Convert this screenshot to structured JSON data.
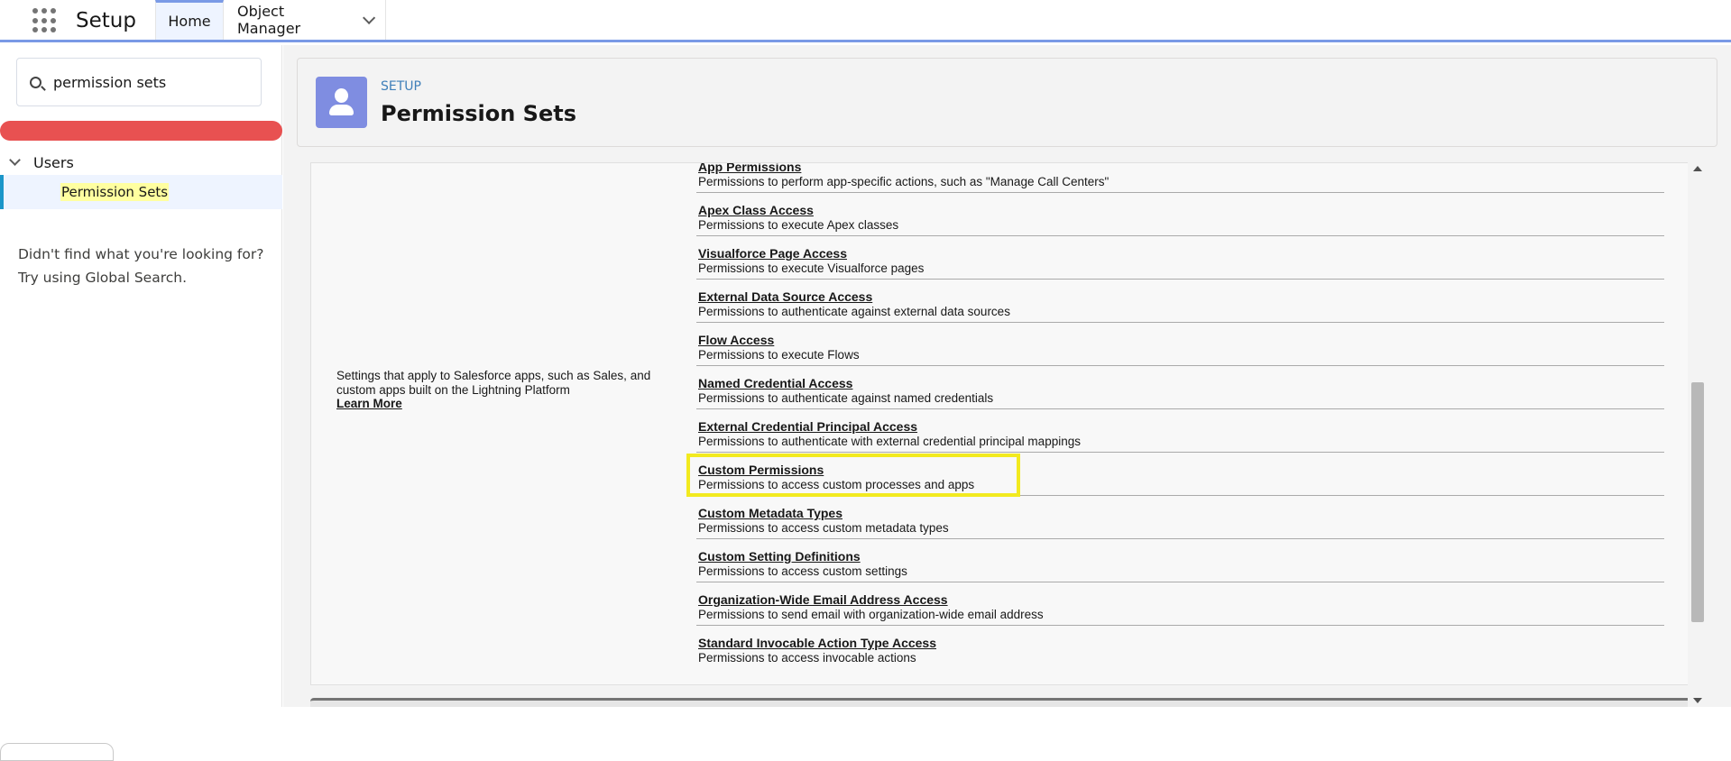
{
  "app": {
    "title": "Setup",
    "launcher_icon": "app-launcher-icon"
  },
  "nav": {
    "tabs": [
      {
        "label": "Home",
        "active": true
      },
      {
        "label": "Object Manager",
        "has_dropdown": true
      }
    ]
  },
  "sidebar": {
    "search": {
      "value": "permission sets",
      "placeholder": "Quick Find"
    },
    "tree": {
      "group_label": "Users",
      "item_label": "Permission Sets"
    },
    "not_found_line1": "Didn't find what you're looking for?",
    "not_found_line2": "Try using Global Search."
  },
  "header": {
    "breadcrumb": "SETUP",
    "title": "Permission Sets",
    "icon_color": "#7f8de1"
  },
  "content": {
    "description": "Settings that apply to Salesforce apps, such as Sales, and custom apps built on the Lightning Platform",
    "learn_more": "Learn More",
    "permissions": [
      {
        "title": "App Permissions",
        "desc": "Permissions to perform app-specific actions, such as \"Manage Call Centers\""
      },
      {
        "title": "Apex Class Access",
        "desc": "Permissions to execute Apex classes"
      },
      {
        "title": "Visualforce Page Access",
        "desc": "Permissions to execute Visualforce pages"
      },
      {
        "title": "External Data Source Access",
        "desc": "Permissions to authenticate against external data sources"
      },
      {
        "title": "Flow Access",
        "desc": "Permissions to execute Flows"
      },
      {
        "title": "Named Credential Access",
        "desc": "Permissions to authenticate against named credentials"
      },
      {
        "title": "External Credential Principal Access",
        "desc": "Permissions to authenticate with external credential principal mappings"
      },
      {
        "title": "Custom Permissions",
        "desc": "Permissions to access custom processes and apps",
        "highlighted": true
      },
      {
        "title": "Custom Metadata Types",
        "desc": "Permissions to access custom metadata types"
      },
      {
        "title": "Custom Setting Definitions",
        "desc": "Permissions to access custom settings"
      },
      {
        "title": "Organization-Wide Email Address Access",
        "desc": "Permissions to send email with organization-wide email address"
      },
      {
        "title": "Standard Invocable Action Type Access",
        "desc": "Permissions to access invocable actions"
      }
    ]
  },
  "colors": {
    "accent": "#7a9ae6",
    "highlight": "#f2ea1f",
    "search_bar_red": "#e85151",
    "selected_bg": "#eef4ff"
  }
}
